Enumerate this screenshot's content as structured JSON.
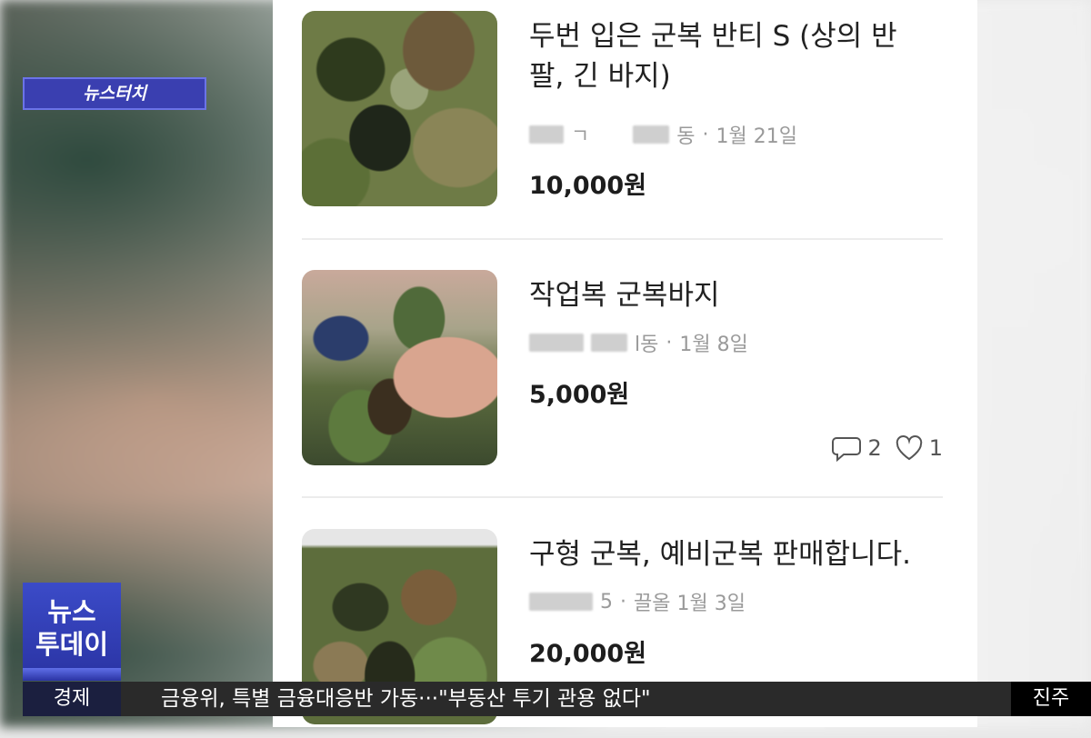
{
  "badge": {
    "news_touch": "뉴스터치"
  },
  "listings": [
    {
      "title": "두번 입은 군복 반티 S (상의 반팔, 긴 바지)",
      "location_fragment_1": "ㄱ",
      "location_fragment_2": "동",
      "date": "1월 21일",
      "price": "10,000원"
    },
    {
      "title": "작업복 군복바지",
      "location_fragment_1": "",
      "location_fragment_2": "l동",
      "date": "1월 8일",
      "price": "5,000원",
      "comments": "2",
      "likes": "1"
    },
    {
      "title": "구형 군복, 예비군복 판매합니다.",
      "location_fragment_1": "",
      "location_fragment_2": "5",
      "date": "끌올 1월 3일",
      "price": "20,000원"
    }
  ],
  "logo": {
    "line1": "뉴스",
    "line2": "투데이"
  },
  "ticker": {
    "category": "경제",
    "headline": "금융위, 특별 금융대응반 가동···\"부동산 투기 관용 없다\"",
    "region": "진주"
  },
  "colors": {
    "brand_blue": "#3a3fb0",
    "ticker_bg": "#2a2a2a"
  },
  "icons": [
    "chat-bubble-icon",
    "heart-icon"
  ]
}
